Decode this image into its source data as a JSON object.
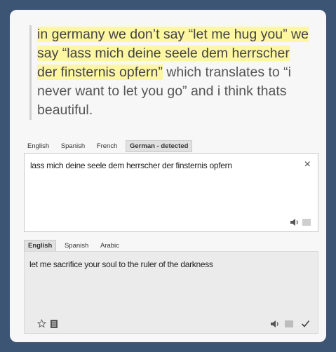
{
  "post": {
    "highlighted_text": "in germany we don’t say “let me hug you” we say “lass mich deine seele dem herrscher der finsternis opfern”",
    "plain_text": " which translates to “i never want to let you go” and i think thats beautiful."
  },
  "source_languages": [
    {
      "label": "English",
      "active": false
    },
    {
      "label": "Spanish",
      "active": false
    },
    {
      "label": "French",
      "active": false
    },
    {
      "label": "German - detected",
      "active": true
    }
  ],
  "source": {
    "text": "lass mich deine seele dem herrscher der finsternis opfern",
    "clear_icon": "×"
  },
  "target_languages": [
    {
      "label": "English",
      "active": true
    },
    {
      "label": "Spanish",
      "active": false
    },
    {
      "label": "Arabic",
      "active": false
    }
  ],
  "target": {
    "text": "let me sacrifice your soul to the ruler of the darkness"
  },
  "icons": {
    "source": [
      "speaker-icon",
      "keyboard-icon"
    ],
    "target_left": [
      "star-icon",
      "phrasebook-icon"
    ],
    "target_right": [
      "speaker-icon",
      "copy-icon",
      "check-icon"
    ]
  },
  "colors": {
    "background": "#3c5575",
    "highlight": "#fdf6a3"
  }
}
